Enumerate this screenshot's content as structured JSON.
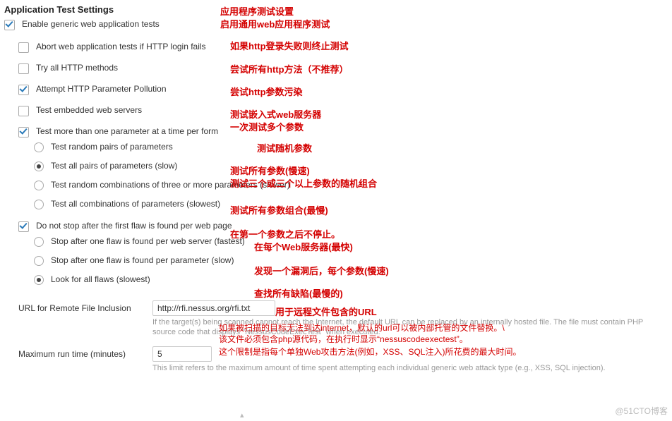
{
  "heading": "Application Test Settings",
  "annotations": {
    "heading": "应用程序测试设置",
    "enable": "启用通用web应用程序测试",
    "abort": "如果http登录失败则终止测试",
    "try_all": "尝试所有http方法（不推荐）",
    "attempt": "尝试http参数污染",
    "embedded": "测试嵌入式web服务器",
    "multi_param": "一次测试多个参数",
    "rand_pairs": "测试随机参数",
    "all_pairs": "测试所有参数(慢速)",
    "rand_comb": "测试三个或三个以上参数的随机组合",
    "all_comb": "测试所有参数组合(最慢)",
    "no_stop": "在第一个参数之后不停止。",
    "per_server": "在每个Web服务器(最快)",
    "per_param": "发现一个漏洞后，每个参数(慢速)",
    "look_all": "查找所有缺陷(最慢的)",
    "rfi_url": "用于远程文件包含的URL",
    "rfi_hint1": "如果被扫描的目标无法到达internet，默认的url可以被内部托管的文件替换。\\",
    "rfi_hint2": "该文件必须包含php源代码，在执行时显示“nessuscodeexectest”。",
    "runtime": "这个限制是指每个单独Web攻击方法(例如，XSS、SQL注入)所花费的最大时间。"
  },
  "opts": {
    "enable": "Enable generic web application tests",
    "abort": "Abort web application tests if HTTP login fails",
    "try_all": "Try all HTTP methods",
    "attempt": "Attempt HTTP Parameter Pollution",
    "embedded": "Test embedded web servers",
    "multi_param": "Test more than one parameter at a time per form",
    "rand_pairs": "Test random pairs of parameters",
    "all_pairs": "Test all pairs of parameters (slow)",
    "rand_comb": "Test random combinations of three or more parameters (slower)",
    "all_comb": "Test all combinations of parameters (slowest)",
    "no_stop": "Do not stop after the first flaw is found per web page",
    "per_server": "Stop after one flaw is found per web server (fastest)",
    "per_param": "Stop after one flaw is found per parameter (slow)",
    "look_all": "Look for all flaws (slowest)"
  },
  "rfi": {
    "label": "URL for Remote File Inclusion",
    "value": "http://rfi.nessus.org/rfi.txt",
    "hint": "If the target(s) being scanned cannot reach the Internet, the default URL can be replaced by an internally hosted file. The file must contain PHP source code that displays \"NessusCodeExecTest\" when executed."
  },
  "runtime": {
    "label": "Maximum run time (minutes)",
    "value": "5",
    "hint": "This limit refers to the maximum amount of time spent attempting each individual generic web attack type (e.g., XSS, SQL injection)."
  },
  "watermark": "@51CTO博客",
  "caret": "▴"
}
